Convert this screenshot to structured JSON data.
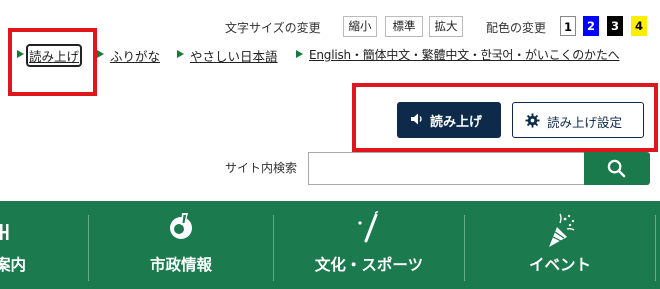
{
  "text_size": {
    "label": "文字サイズの変更",
    "options": [
      "縮小",
      "標準",
      "拡大"
    ]
  },
  "color_scheme": {
    "label": "配色の変更",
    "options": [
      {
        "label": "1",
        "bg": "#ffffff",
        "fg": "#000000"
      },
      {
        "label": "2",
        "bg": "#0000ff",
        "fg": "#ffffff"
      },
      {
        "label": "3",
        "bg": "#000000",
        "fg": "#ffffff"
      },
      {
        "label": "4",
        "bg": "#ffee00",
        "fg": "#000000"
      }
    ]
  },
  "reading_links": [
    {
      "label": "読み上げ"
    },
    {
      "label": "ふりがな"
    },
    {
      "label": "やさしい日本語"
    },
    {
      "label": "English・簡体中文・繁體中文・한국어・がいこくのかたへ"
    }
  ],
  "read_aloud": {
    "read_label": "読み上げ",
    "settings_label": "読み上げ設定",
    "read_icon": "speaker-icon",
    "settings_icon": "gear-icon"
  },
  "search": {
    "label": "サイト内検索",
    "placeholder": "",
    "icon": "search-icon"
  },
  "nav": {
    "items": [
      {
        "label": "案内",
        "icon": "map-icon"
      },
      {
        "label": "市政情報",
        "icon": "city-emblem-icon"
      },
      {
        "label": "文化・スポーツ",
        "icon": "baton-icon"
      },
      {
        "label": "イベント",
        "icon": "party-popper-icon"
      }
    ]
  },
  "colors": {
    "nav_green": "#1b7a4e",
    "navy": "#0d2a4a",
    "highlight_red": "#e0161f",
    "marker_green": "#1a7a3c"
  }
}
